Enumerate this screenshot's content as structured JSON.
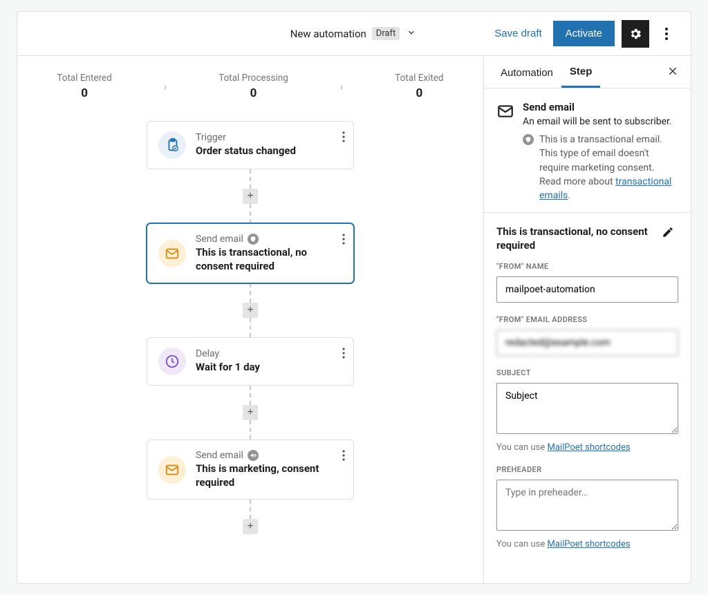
{
  "toolbar": {
    "title": "New automation",
    "status_chip": "Draft",
    "save_draft": "Save draft",
    "activate": "Activate"
  },
  "stats": {
    "entered": {
      "label": "Total Entered",
      "value": "0"
    },
    "processing": {
      "label": "Total Processing",
      "value": "0"
    },
    "exited": {
      "label": "Total Exited",
      "value": "0"
    }
  },
  "steps": [
    {
      "type_label": "Trigger",
      "title": "Order status changed",
      "icon": "trigger"
    },
    {
      "type_label": "Send email",
      "title": "This is transactional, no consent required",
      "icon": "email",
      "badge": "transactional",
      "selected": true
    },
    {
      "type_label": "Delay",
      "title": "Wait for 1 day",
      "icon": "delay"
    },
    {
      "type_label": "Send email",
      "title": "This is marketing, consent required",
      "icon": "email",
      "badge": "marketing"
    }
  ],
  "sidebar": {
    "tabs": {
      "automation": "Automation",
      "step": "Step"
    },
    "active_tab": "step",
    "step_header": {
      "title": "Send email",
      "description": "An email will be sent to subscriber.",
      "info_text": "This is a transactional email. This type of email doesn't require marketing consent. Read more about ",
      "info_link_text": "transactional emails"
    },
    "email_name": "This is transactional, no consent required",
    "fields": {
      "from_name": {
        "label": "\"FROM\" NAME",
        "value": "mailpoet-automation"
      },
      "from_email": {
        "label": "\"FROM\" EMAIL ADDRESS",
        "value": "redacted@example.com"
      },
      "subject": {
        "label": "SUBJECT",
        "value": "Subject",
        "helper": "You can use ",
        "helper_link": "MailPoet shortcodes"
      },
      "preheader": {
        "label": "PREHEADER",
        "placeholder": "Type in preheader…",
        "helper": "You can use ",
        "helper_link": "MailPoet shortcodes"
      }
    }
  }
}
